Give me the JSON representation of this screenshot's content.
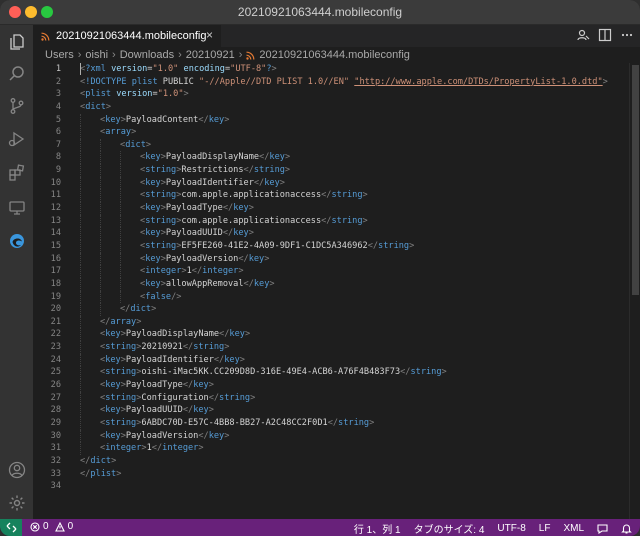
{
  "window": {
    "title": "20210921063444.mobileconfig"
  },
  "tab": {
    "label": "20210921063444.mobileconfig",
    "close": "×"
  },
  "breadcrumb": [
    "Users",
    "oishi",
    "Downloads",
    "20210921",
    "20210921063444.mobileconfig"
  ],
  "editor": {
    "lines": [
      {
        "n": "1",
        "indent": 0,
        "segs": [
          {
            "c": "bk",
            "t": "<"
          },
          {
            "c": "tg",
            "t": "?xml"
          },
          {
            "c": "tx",
            "t": " "
          },
          {
            "c": "at",
            "t": "version"
          },
          {
            "c": "tx",
            "t": "="
          },
          {
            "c": "st",
            "t": "\"1.0\""
          },
          {
            "c": "tx",
            "t": " "
          },
          {
            "c": "at",
            "t": "encoding"
          },
          {
            "c": "tx",
            "t": "="
          },
          {
            "c": "st",
            "t": "\"UTF-8\""
          },
          {
            "c": "tg",
            "t": "?"
          },
          {
            "c": "bk",
            "t": ">"
          }
        ]
      },
      {
        "n": "2",
        "indent": 0,
        "segs": [
          {
            "c": "bk",
            "t": "<"
          },
          {
            "c": "tg",
            "t": "!DOCTYPE plist"
          },
          {
            "c": "tx",
            "t": " PUBLIC "
          },
          {
            "c": "st",
            "t": "\"-//Apple//DTD PLIST 1.0//EN\""
          },
          {
            "c": "tx",
            "t": " "
          },
          {
            "c": "lk",
            "t": "\"http://www.apple.com/DTDs/PropertyList-1.0.dtd\""
          },
          {
            "c": "bk",
            "t": ">"
          }
        ]
      },
      {
        "n": "3",
        "indent": 0,
        "segs": [
          {
            "c": "bk",
            "t": "<"
          },
          {
            "c": "tg",
            "t": "plist"
          },
          {
            "c": "tx",
            "t": " "
          },
          {
            "c": "at",
            "t": "version"
          },
          {
            "c": "tx",
            "t": "="
          },
          {
            "c": "st",
            "t": "\"1.0\""
          },
          {
            "c": "bk",
            "t": ">"
          }
        ]
      },
      {
        "n": "4",
        "indent": 0,
        "segs": [
          {
            "c": "bk",
            "t": "<"
          },
          {
            "c": "tg",
            "t": "dict"
          },
          {
            "c": "bk",
            "t": ">"
          }
        ]
      },
      {
        "n": "5",
        "indent": 1,
        "segs": [
          {
            "c": "bk",
            "t": "<"
          },
          {
            "c": "tg",
            "t": "key"
          },
          {
            "c": "bk",
            "t": ">"
          },
          {
            "c": "tx",
            "t": "PayloadContent"
          },
          {
            "c": "bk",
            "t": "</"
          },
          {
            "c": "tg",
            "t": "key"
          },
          {
            "c": "bk",
            "t": ">"
          }
        ]
      },
      {
        "n": "6",
        "indent": 1,
        "segs": [
          {
            "c": "bk",
            "t": "<"
          },
          {
            "c": "tg",
            "t": "array"
          },
          {
            "c": "bk",
            "t": ">"
          }
        ]
      },
      {
        "n": "7",
        "indent": 2,
        "segs": [
          {
            "c": "bk",
            "t": "<"
          },
          {
            "c": "tg",
            "t": "dict"
          },
          {
            "c": "bk",
            "t": ">"
          }
        ]
      },
      {
        "n": "8",
        "indent": 3,
        "segs": [
          {
            "c": "bk",
            "t": "<"
          },
          {
            "c": "tg",
            "t": "key"
          },
          {
            "c": "bk",
            "t": ">"
          },
          {
            "c": "tx",
            "t": "PayloadDisplayName"
          },
          {
            "c": "bk",
            "t": "</"
          },
          {
            "c": "tg",
            "t": "key"
          },
          {
            "c": "bk",
            "t": ">"
          }
        ]
      },
      {
        "n": "9",
        "indent": 3,
        "segs": [
          {
            "c": "bk",
            "t": "<"
          },
          {
            "c": "tg",
            "t": "string"
          },
          {
            "c": "bk",
            "t": ">"
          },
          {
            "c": "tx",
            "t": "Restrictions"
          },
          {
            "c": "bk",
            "t": "</"
          },
          {
            "c": "tg",
            "t": "string"
          },
          {
            "c": "bk",
            "t": ">"
          }
        ]
      },
      {
        "n": "10",
        "indent": 3,
        "segs": [
          {
            "c": "bk",
            "t": "<"
          },
          {
            "c": "tg",
            "t": "key"
          },
          {
            "c": "bk",
            "t": ">"
          },
          {
            "c": "tx",
            "t": "PayloadIdentifier"
          },
          {
            "c": "bk",
            "t": "</"
          },
          {
            "c": "tg",
            "t": "key"
          },
          {
            "c": "bk",
            "t": ">"
          }
        ]
      },
      {
        "n": "11",
        "indent": 3,
        "segs": [
          {
            "c": "bk",
            "t": "<"
          },
          {
            "c": "tg",
            "t": "string"
          },
          {
            "c": "bk",
            "t": ">"
          },
          {
            "c": "tx",
            "t": "com.apple.applicationaccess"
          },
          {
            "c": "bk",
            "t": "</"
          },
          {
            "c": "tg",
            "t": "string"
          },
          {
            "c": "bk",
            "t": ">"
          }
        ]
      },
      {
        "n": "12",
        "indent": 3,
        "segs": [
          {
            "c": "bk",
            "t": "<"
          },
          {
            "c": "tg",
            "t": "key"
          },
          {
            "c": "bk",
            "t": ">"
          },
          {
            "c": "tx",
            "t": "PayloadType"
          },
          {
            "c": "bk",
            "t": "</"
          },
          {
            "c": "tg",
            "t": "key"
          },
          {
            "c": "bk",
            "t": ">"
          }
        ]
      },
      {
        "n": "13",
        "indent": 3,
        "segs": [
          {
            "c": "bk",
            "t": "<"
          },
          {
            "c": "tg",
            "t": "string"
          },
          {
            "c": "bk",
            "t": ">"
          },
          {
            "c": "tx",
            "t": "com.apple.applicationaccess"
          },
          {
            "c": "bk",
            "t": "</"
          },
          {
            "c": "tg",
            "t": "string"
          },
          {
            "c": "bk",
            "t": ">"
          }
        ]
      },
      {
        "n": "14",
        "indent": 3,
        "segs": [
          {
            "c": "bk",
            "t": "<"
          },
          {
            "c": "tg",
            "t": "key"
          },
          {
            "c": "bk",
            "t": ">"
          },
          {
            "c": "tx",
            "t": "PayloadUUID"
          },
          {
            "c": "bk",
            "t": "</"
          },
          {
            "c": "tg",
            "t": "key"
          },
          {
            "c": "bk",
            "t": ">"
          }
        ]
      },
      {
        "n": "15",
        "indent": 3,
        "segs": [
          {
            "c": "bk",
            "t": "<"
          },
          {
            "c": "tg",
            "t": "string"
          },
          {
            "c": "bk",
            "t": ">"
          },
          {
            "c": "tx",
            "t": "EF5FE260-41E2-4A09-9DF1-C1DC5A346962"
          },
          {
            "c": "bk",
            "t": "</"
          },
          {
            "c": "tg",
            "t": "string"
          },
          {
            "c": "bk",
            "t": ">"
          }
        ]
      },
      {
        "n": "16",
        "indent": 3,
        "segs": [
          {
            "c": "bk",
            "t": "<"
          },
          {
            "c": "tg",
            "t": "key"
          },
          {
            "c": "bk",
            "t": ">"
          },
          {
            "c": "tx",
            "t": "PayloadVersion"
          },
          {
            "c": "bk",
            "t": "</"
          },
          {
            "c": "tg",
            "t": "key"
          },
          {
            "c": "bk",
            "t": ">"
          }
        ]
      },
      {
        "n": "17",
        "indent": 3,
        "segs": [
          {
            "c": "bk",
            "t": "<"
          },
          {
            "c": "tg",
            "t": "integer"
          },
          {
            "c": "bk",
            "t": ">"
          },
          {
            "c": "tx",
            "t": "1"
          },
          {
            "c": "bk",
            "t": "</"
          },
          {
            "c": "tg",
            "t": "integer"
          },
          {
            "c": "bk",
            "t": ">"
          }
        ]
      },
      {
        "n": "18",
        "indent": 3,
        "segs": [
          {
            "c": "bk",
            "t": "<"
          },
          {
            "c": "tg",
            "t": "key"
          },
          {
            "c": "bk",
            "t": ">"
          },
          {
            "c": "tx",
            "t": "allowAppRemoval"
          },
          {
            "c": "bk",
            "t": "</"
          },
          {
            "c": "tg",
            "t": "key"
          },
          {
            "c": "bk",
            "t": ">"
          }
        ]
      },
      {
        "n": "19",
        "indent": 3,
        "segs": [
          {
            "c": "bk",
            "t": "<"
          },
          {
            "c": "tg",
            "t": "false"
          },
          {
            "c": "bk",
            "t": "/>"
          }
        ]
      },
      {
        "n": "20",
        "indent": 2,
        "segs": [
          {
            "c": "bk",
            "t": "</"
          },
          {
            "c": "tg",
            "t": "dict"
          },
          {
            "c": "bk",
            "t": ">"
          }
        ]
      },
      {
        "n": "21",
        "indent": 1,
        "segs": [
          {
            "c": "bk",
            "t": "</"
          },
          {
            "c": "tg",
            "t": "array"
          },
          {
            "c": "bk",
            "t": ">"
          }
        ]
      },
      {
        "n": "22",
        "indent": 1,
        "segs": [
          {
            "c": "bk",
            "t": "<"
          },
          {
            "c": "tg",
            "t": "key"
          },
          {
            "c": "bk",
            "t": ">"
          },
          {
            "c": "tx",
            "t": "PayloadDisplayName"
          },
          {
            "c": "bk",
            "t": "</"
          },
          {
            "c": "tg",
            "t": "key"
          },
          {
            "c": "bk",
            "t": ">"
          }
        ]
      },
      {
        "n": "23",
        "indent": 1,
        "segs": [
          {
            "c": "bk",
            "t": "<"
          },
          {
            "c": "tg",
            "t": "string"
          },
          {
            "c": "bk",
            "t": ">"
          },
          {
            "c": "tx",
            "t": "20210921"
          },
          {
            "c": "bk",
            "t": "</"
          },
          {
            "c": "tg",
            "t": "string"
          },
          {
            "c": "bk",
            "t": ">"
          }
        ]
      },
      {
        "n": "24",
        "indent": 1,
        "segs": [
          {
            "c": "bk",
            "t": "<"
          },
          {
            "c": "tg",
            "t": "key"
          },
          {
            "c": "bk",
            "t": ">"
          },
          {
            "c": "tx",
            "t": "PayloadIdentifier"
          },
          {
            "c": "bk",
            "t": "</"
          },
          {
            "c": "tg",
            "t": "key"
          },
          {
            "c": "bk",
            "t": ">"
          }
        ]
      },
      {
        "n": "25",
        "indent": 1,
        "segs": [
          {
            "c": "bk",
            "t": "<"
          },
          {
            "c": "tg",
            "t": "string"
          },
          {
            "c": "bk",
            "t": ">"
          },
          {
            "c": "tx",
            "t": "oishi-iMac5KK.CC209D8D-316E-49E4-ACB6-A76F4B483F73"
          },
          {
            "c": "bk",
            "t": "</"
          },
          {
            "c": "tg",
            "t": "string"
          },
          {
            "c": "bk",
            "t": ">"
          }
        ]
      },
      {
        "n": "26",
        "indent": 1,
        "segs": [
          {
            "c": "bk",
            "t": "<"
          },
          {
            "c": "tg",
            "t": "key"
          },
          {
            "c": "bk",
            "t": ">"
          },
          {
            "c": "tx",
            "t": "PayloadType"
          },
          {
            "c": "bk",
            "t": "</"
          },
          {
            "c": "tg",
            "t": "key"
          },
          {
            "c": "bk",
            "t": ">"
          }
        ]
      },
      {
        "n": "27",
        "indent": 1,
        "segs": [
          {
            "c": "bk",
            "t": "<"
          },
          {
            "c": "tg",
            "t": "string"
          },
          {
            "c": "bk",
            "t": ">"
          },
          {
            "c": "tx",
            "t": "Configuration"
          },
          {
            "c": "bk",
            "t": "</"
          },
          {
            "c": "tg",
            "t": "string"
          },
          {
            "c": "bk",
            "t": ">"
          }
        ]
      },
      {
        "n": "28",
        "indent": 1,
        "segs": [
          {
            "c": "bk",
            "t": "<"
          },
          {
            "c": "tg",
            "t": "key"
          },
          {
            "c": "bk",
            "t": ">"
          },
          {
            "c": "tx",
            "t": "PayloadUUID"
          },
          {
            "c": "bk",
            "t": "</"
          },
          {
            "c": "tg",
            "t": "key"
          },
          {
            "c": "bk",
            "t": ">"
          }
        ]
      },
      {
        "n": "29",
        "indent": 1,
        "segs": [
          {
            "c": "bk",
            "t": "<"
          },
          {
            "c": "tg",
            "t": "string"
          },
          {
            "c": "bk",
            "t": ">"
          },
          {
            "c": "tx",
            "t": "6ABDC70D-E57C-4BB8-BB27-A2C48CC2F0D1"
          },
          {
            "c": "bk",
            "t": "</"
          },
          {
            "c": "tg",
            "t": "string"
          },
          {
            "c": "bk",
            "t": ">"
          }
        ]
      },
      {
        "n": "30",
        "indent": 1,
        "segs": [
          {
            "c": "bk",
            "t": "<"
          },
          {
            "c": "tg",
            "t": "key"
          },
          {
            "c": "bk",
            "t": ">"
          },
          {
            "c": "tx",
            "t": "PayloadVersion"
          },
          {
            "c": "bk",
            "t": "</"
          },
          {
            "c": "tg",
            "t": "key"
          },
          {
            "c": "bk",
            "t": ">"
          }
        ]
      },
      {
        "n": "31",
        "indent": 1,
        "segs": [
          {
            "c": "bk",
            "t": "<"
          },
          {
            "c": "tg",
            "t": "integer"
          },
          {
            "c": "bk",
            "t": ">"
          },
          {
            "c": "tx",
            "t": "1"
          },
          {
            "c": "bk",
            "t": "</"
          },
          {
            "c": "tg",
            "t": "integer"
          },
          {
            "c": "bk",
            "t": ">"
          }
        ]
      },
      {
        "n": "32",
        "indent": 0,
        "segs": [
          {
            "c": "bk",
            "t": "</"
          },
          {
            "c": "tg",
            "t": "dict"
          },
          {
            "c": "bk",
            "t": ">"
          }
        ]
      },
      {
        "n": "33",
        "indent": 0,
        "segs": [
          {
            "c": "bk",
            "t": "</"
          },
          {
            "c": "tg",
            "t": "plist"
          },
          {
            "c": "bk",
            "t": ">"
          }
        ]
      },
      {
        "n": "34",
        "indent": 0,
        "segs": []
      }
    ]
  },
  "statusbar": {
    "errors": "0",
    "warnings": "0",
    "position": "行 1、列 1",
    "tab_size": "タブのサイズ: 4",
    "encoding": "UTF-8",
    "eol": "LF",
    "language": "XML"
  },
  "icons": [
    "files-icon",
    "search-icon",
    "source-control-icon",
    "run-debug-icon",
    "extensions-icon",
    "remote-explorer-icon",
    "edge-icon",
    "account-icon",
    "settings-gear-icon",
    "rss-icon",
    "split-editor-icon",
    "more-actions-icon",
    "live-share-icon",
    "remote-icon",
    "error-icon",
    "warning-icon",
    "feedback-icon",
    "bell-icon"
  ],
  "colors": {
    "statusbar": "#68217a",
    "remote": "#16825d",
    "editor_bg": "#1e1e1e",
    "tag": "#569cd6",
    "attr": "#9cdcfe",
    "string": "#ce9178"
  }
}
